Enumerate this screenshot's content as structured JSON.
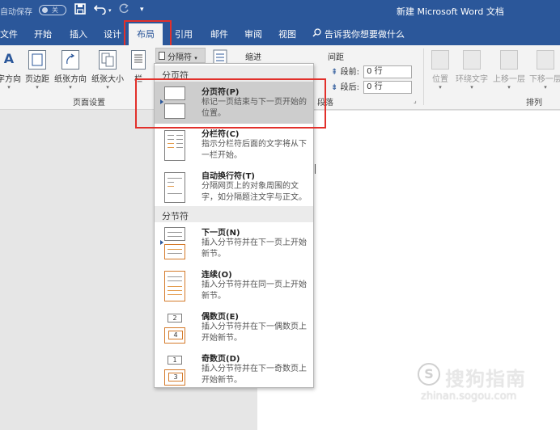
{
  "titlebar": {
    "autosave_label": "自动保存",
    "autosave_state": "关",
    "save_icon": "save-icon",
    "undo_icon": "undo-icon",
    "redo_icon": "redo-icon",
    "customize_icon": "customize-qat-icon",
    "title": "新建 Microsoft Word 文档"
  },
  "tabs": [
    {
      "label": "文件"
    },
    {
      "label": "开始"
    },
    {
      "label": "插入"
    },
    {
      "label": "设计"
    },
    {
      "label": "布局"
    },
    {
      "label": "引用"
    },
    {
      "label": "邮件"
    },
    {
      "label": "审阅"
    },
    {
      "label": "视图"
    }
  ],
  "tell_me": "告诉我你想要做什么",
  "ribbon": {
    "page_setup": {
      "text_direction": "字方向",
      "margins": "页边距",
      "orientation": "纸张方向",
      "size": "纸张大小",
      "columns": "栏",
      "group_label": "页面设置"
    },
    "breaks_label": "分隔符",
    "indent_label": "缩进",
    "spacing_label": "间距",
    "before_label": "段前:",
    "before_value": "0 行",
    "after_label": "段后:",
    "after_value": "0 行",
    "paragraph_group_label": "段落",
    "arrange": {
      "position": "位置",
      "wrap_text": "环绕文字",
      "bring_forward": "上移一层",
      "send_backward": "下移一层",
      "group_label": "排列"
    }
  },
  "menu": {
    "page_breaks_header": "分页符",
    "section_breaks_header": "分节符",
    "items": [
      {
        "title": "分页符(P)",
        "desc": "标记一页结束与下一页开始的位置。"
      },
      {
        "title": "分栏符(C)",
        "desc": "指示分栏符后面的文字将从下一栏开始。"
      },
      {
        "title": "自动换行符(T)",
        "desc": "分隔网页上的对象周围的文字，如分隔题注文字与正文。"
      },
      {
        "title": "下一页(N)",
        "desc": "插入分节符并在下一页上开始新节。"
      },
      {
        "title": "连续(O)",
        "desc": "插入分节符并在同一页上开始新节。"
      },
      {
        "title": "偶数页(E)",
        "desc": "插入分节符并在下一偶数页上开始新节。"
      },
      {
        "title": "奇数页(D)",
        "desc": "插入分节符并在下一奇数页上开始新节。"
      }
    ],
    "even_nums": [
      "2",
      "4"
    ],
    "odd_nums": [
      "1",
      "3"
    ]
  },
  "watermark": {
    "logo": "S",
    "text": "搜狗指南",
    "url": "zhinan.sogou.com"
  },
  "colors": {
    "accent": "#2b579a",
    "highlight": "#e2302b"
  }
}
